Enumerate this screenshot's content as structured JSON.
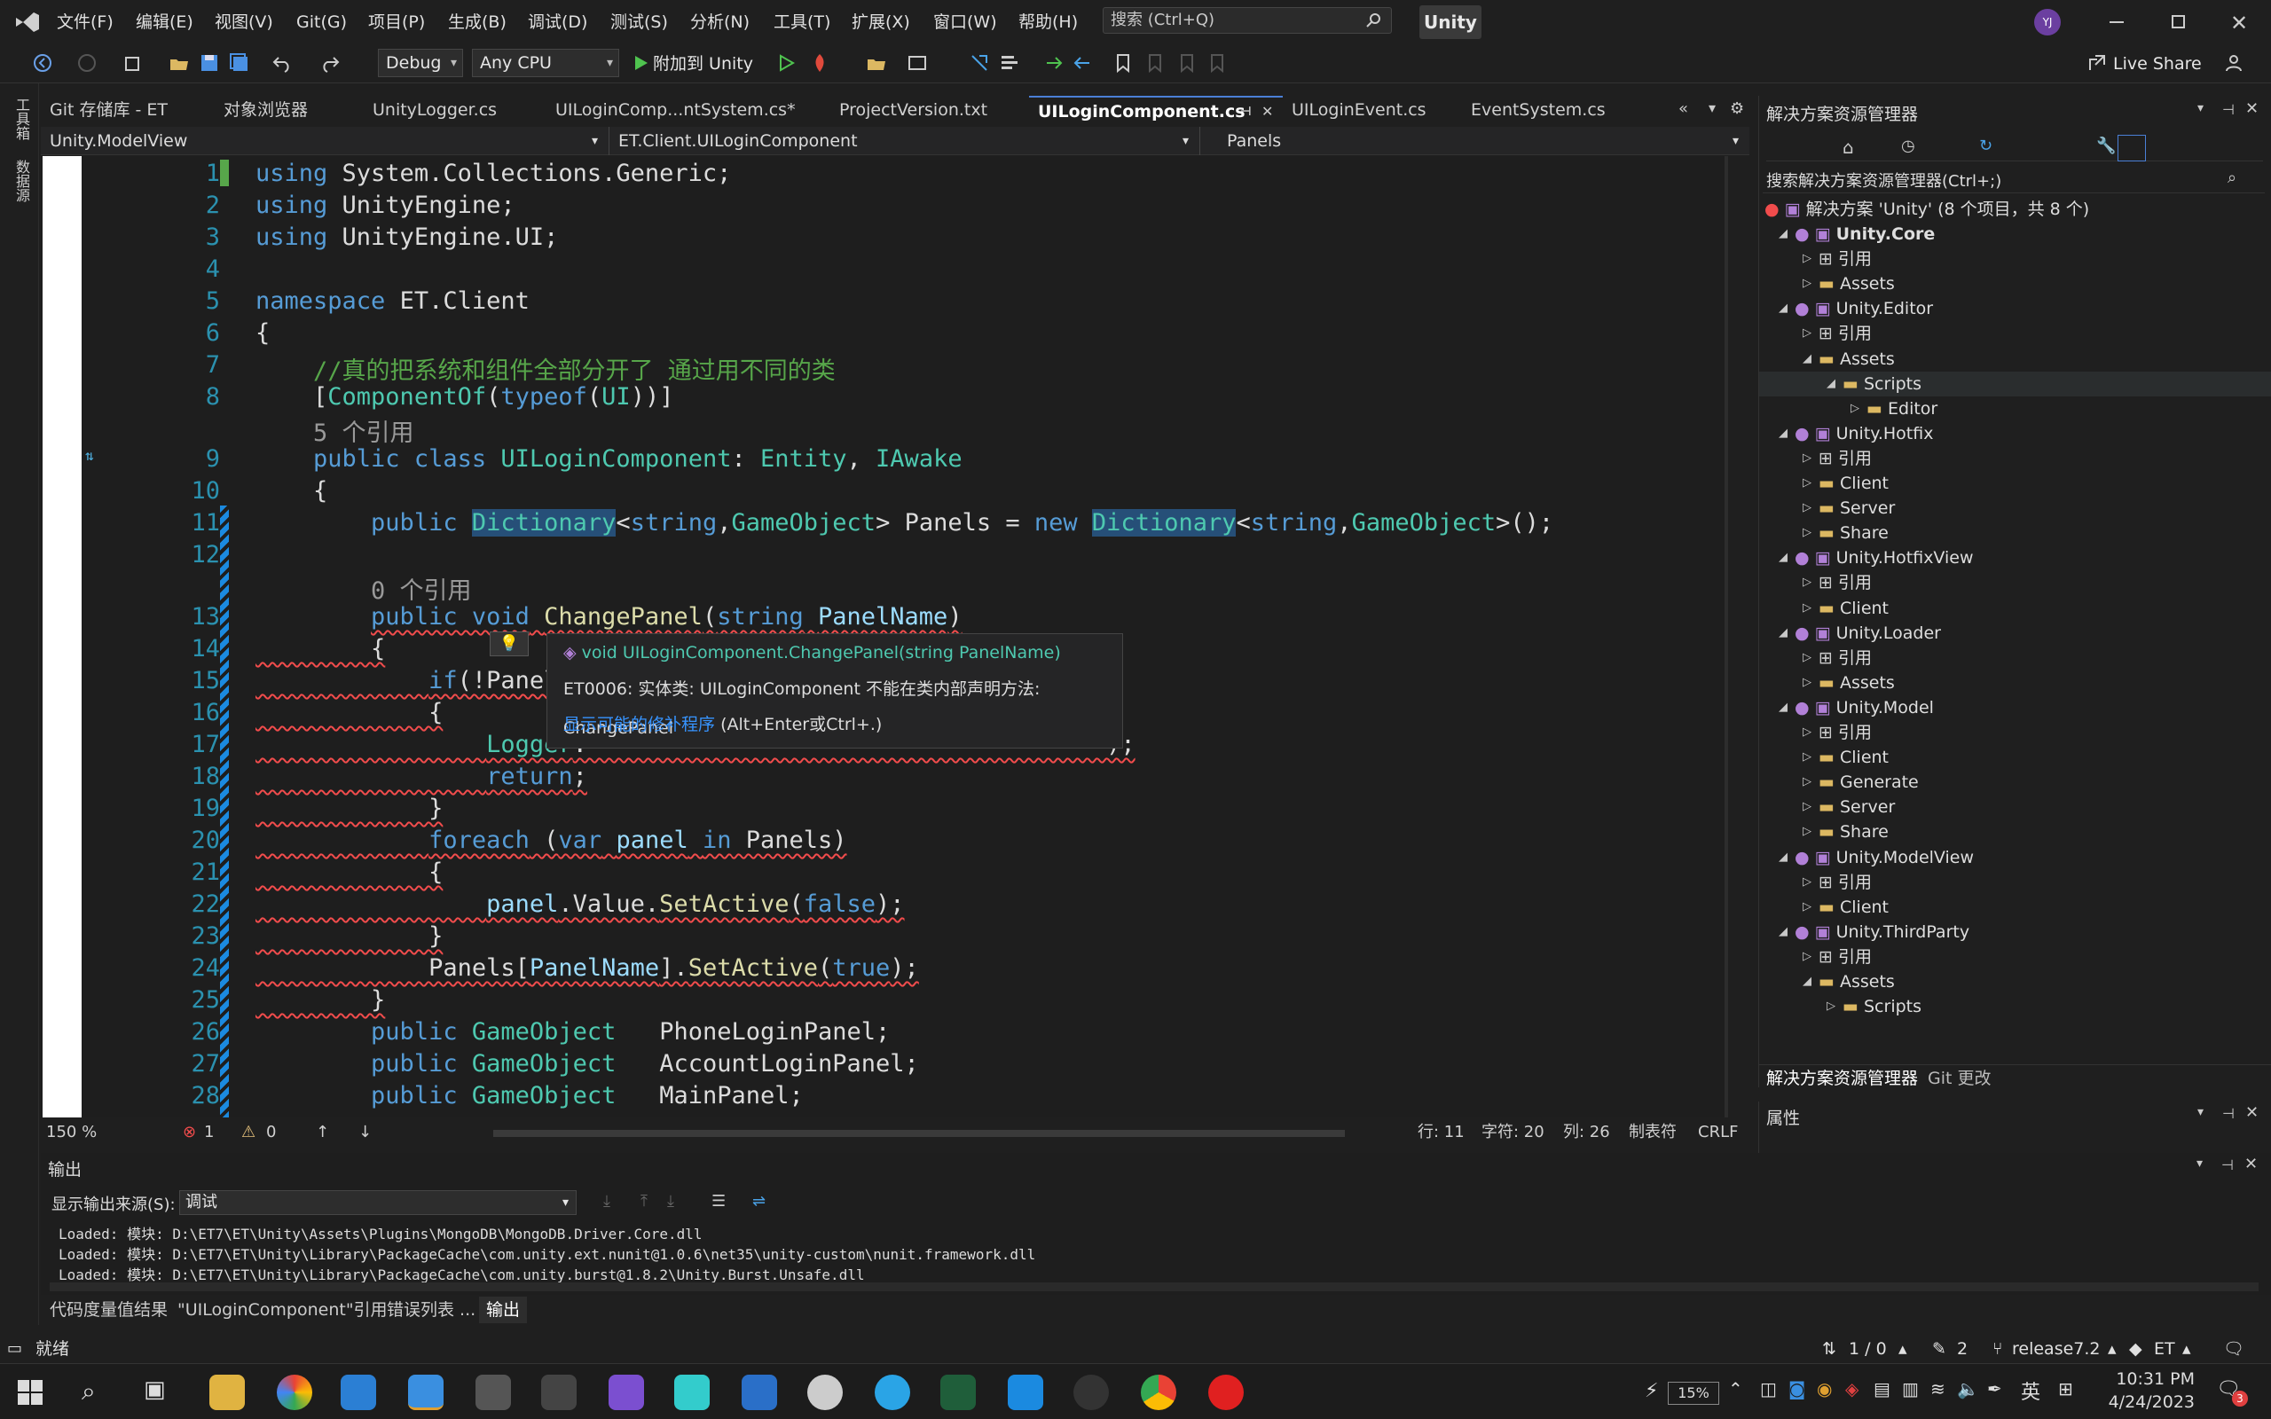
{
  "titlebar": {
    "menus": [
      "文件(F)",
      "编辑(E)",
      "视图(V)",
      "Git(G)",
      "项目(P)",
      "生成(B)",
      "调试(D)",
      "测试(S)",
      "分析(N)",
      "工具(T)",
      "扩展(X)",
      "窗口(W)",
      "帮助(H)"
    ],
    "search_placeholder": "搜索 (Ctrl+Q)",
    "solution_badge": "Unity",
    "avatar": "YJ"
  },
  "toolbar": {
    "config": "Debug",
    "platform": "Any CPU",
    "attach": "附加到 Unity",
    "live_share": "Live Share"
  },
  "leftstrip": {
    "items": [
      "工具箱",
      "数据源"
    ]
  },
  "tabs": [
    {
      "label": "Git 存储库 - ET"
    },
    {
      "label": "对象浏览器"
    },
    {
      "label": "UnityLogger.cs"
    },
    {
      "label": "UILoginComp...ntSystem.cs*"
    },
    {
      "label": "ProjectVersion.txt"
    },
    {
      "label": "UILoginComponent.cs",
      "active": true
    },
    {
      "label": "UILoginEvent.cs"
    },
    {
      "label": "EventSystem.cs"
    }
  ],
  "navbar": {
    "project": "Unity.ModelView",
    "type": "ET.Client.UILoginComponent",
    "member": "Panels"
  },
  "code": [
    {
      "n": "1",
      "t": "using System.Collections.Generic;"
    },
    {
      "n": "2",
      "t": "using UnityEngine;"
    },
    {
      "n": "3",
      "t": "using UnityEngine.UI;"
    },
    {
      "n": "4",
      "t": ""
    },
    {
      "n": "5",
      "t": "namespace ET.Client"
    },
    {
      "n": "6",
      "t": "{"
    },
    {
      "n": "7",
      "t": "    //真的把系统和组件全部分开了 通过用不同的类"
    },
    {
      "n": "8",
      "t": "    [ComponentOf(typeof(UI))]"
    },
    {
      "n": "",
      "t": "    5 个引用"
    },
    {
      "n": "9",
      "t": "    public class UILoginComponent: Entity, IAwake"
    },
    {
      "n": "10",
      "t": "    {"
    },
    {
      "n": "11",
      "t": "        public Dictionary<string,GameObject> Panels = new Dictionary<string,GameObject>();"
    },
    {
      "n": "12",
      "t": ""
    },
    {
      "n": "",
      "t": "        0 个引用"
    },
    {
      "n": "13",
      "t": "        public void ChangePanel(string PanelName)"
    },
    {
      "n": "14",
      "t": "        {"
    },
    {
      "n": "15",
      "t": "            if(!Panels."
    },
    {
      "n": "16",
      "t": "            {"
    },
    {
      "n": "17",
      "t": "                Logger."
    },
    {
      "n": "18",
      "t": "                return;"
    },
    {
      "n": "19",
      "t": "            }"
    },
    {
      "n": "20",
      "t": "            foreach (var panel in Panels)"
    },
    {
      "n": "21",
      "t": "            {"
    },
    {
      "n": "22",
      "t": "                panel.Value.SetActive(false);"
    },
    {
      "n": "23",
      "t": "            }"
    },
    {
      "n": "24",
      "t": "            Panels[PanelName].SetActive(true);"
    },
    {
      "n": "25",
      "t": "        }"
    },
    {
      "n": "26",
      "t": "        public GameObject   PhoneLoginPanel;"
    },
    {
      "n": "27",
      "t": "        public GameObject   AccountLoginPanel;"
    },
    {
      "n": "28",
      "t": "        public GameObject   MainPanel;"
    }
  ],
  "tooltip": {
    "signature": "void UILoginComponent.ChangePanel(string PanelName)",
    "error": "ET0006: 实体类: UILoginComponent 不能在类内部声明方法: ChangePanel",
    "fix_link": "显示可能的修补程序",
    "fix_keys": "(Alt+Enter或Ctrl+.)"
  },
  "editor_status": {
    "zoom": "150 %",
    "errors": "1",
    "warnings": "0",
    "line": "行: 11",
    "char": "字符: 20",
    "col": "列: 26",
    "tabs": "制表符",
    "eol": "CRLF"
  },
  "solution_explorer": {
    "title": "解决方案资源管理器",
    "search": "搜索解决方案资源管理器(Ctrl+;)",
    "solution": "解决方案 'Unity' (8 个项目，共 8 个)",
    "items": [
      {
        "label": "Unity.Core",
        "level": 1,
        "bold": true,
        "open": true,
        "kind": "proj"
      },
      {
        "label": "引用",
        "level": 2,
        "kind": "ref"
      },
      {
        "label": "Assets",
        "level": 2,
        "kind": "folder"
      },
      {
        "label": "Unity.Editor",
        "level": 1,
        "open": true,
        "kind": "proj"
      },
      {
        "label": "引用",
        "level": 2,
        "kind": "ref"
      },
      {
        "label": "Assets",
        "level": 2,
        "open": true,
        "kind": "folder"
      },
      {
        "label": "Scripts",
        "level": 3,
        "open": true,
        "kind": "folder",
        "selected": true
      },
      {
        "label": "Editor",
        "level": 4,
        "kind": "folder"
      },
      {
        "label": "Unity.Hotfix",
        "level": 1,
        "open": true,
        "kind": "proj"
      },
      {
        "label": "引用",
        "level": 2,
        "kind": "ref"
      },
      {
        "label": "Client",
        "level": 2,
        "kind": "folder"
      },
      {
        "label": "Server",
        "level": 2,
        "kind": "folder"
      },
      {
        "label": "Share",
        "level": 2,
        "kind": "folder"
      },
      {
        "label": "Unity.HotfixView",
        "level": 1,
        "open": true,
        "kind": "proj"
      },
      {
        "label": "引用",
        "level": 2,
        "kind": "ref"
      },
      {
        "label": "Client",
        "level": 2,
        "kind": "folder"
      },
      {
        "label": "Unity.Loader",
        "level": 1,
        "open": true,
        "kind": "proj"
      },
      {
        "label": "引用",
        "level": 2,
        "kind": "ref"
      },
      {
        "label": "Assets",
        "level": 2,
        "kind": "folder"
      },
      {
        "label": "Unity.Model",
        "level": 1,
        "open": true,
        "kind": "proj"
      },
      {
        "label": "引用",
        "level": 2,
        "kind": "ref"
      },
      {
        "label": "Client",
        "level": 2,
        "kind": "folder"
      },
      {
        "label": "Generate",
        "level": 2,
        "kind": "folder"
      },
      {
        "label": "Server",
        "level": 2,
        "kind": "folder"
      },
      {
        "label": "Share",
        "level": 2,
        "kind": "folder"
      },
      {
        "label": "Unity.ModelView",
        "level": 1,
        "open": true,
        "kind": "proj"
      },
      {
        "label": "引用",
        "level": 2,
        "kind": "ref"
      },
      {
        "label": "Client",
        "level": 2,
        "kind": "folder"
      },
      {
        "label": "Unity.ThirdParty",
        "level": 1,
        "open": true,
        "kind": "proj"
      },
      {
        "label": "引用",
        "level": 2,
        "kind": "ref"
      },
      {
        "label": "Assets",
        "level": 2,
        "open": true,
        "kind": "folder"
      },
      {
        "label": "Scripts",
        "level": 3,
        "kind": "folder"
      }
    ],
    "bottom_tabs": [
      "解决方案资源管理器",
      "Git 更改"
    ]
  },
  "properties": {
    "title": "属性"
  },
  "output": {
    "title": "输出",
    "source_label": "显示输出来源(S):",
    "source_value": "调试",
    "lines": [
      "Loaded: 模块: D:\\ET7\\ET\\Unity\\Assets\\Plugins\\MongoDB\\MongoDB.Driver.Core.dll",
      "Loaded: 模块: D:\\ET7\\ET\\Unity\\Library\\PackageCache\\com.unity.ext.nunit@1.0.6\\net35\\unity-custom\\nunit.framework.dll",
      "Loaded: 模块: D:\\ET7\\ET\\Unity\\Library\\PackageCache\\com.unity.burst@1.8.2\\Unity.Burst.Unsafe.dll"
    ]
  },
  "bottom_tabs": [
    "代码度量值结果",
    "\"UILoginComponent\"引用",
    "错误列表 ...",
    "输出"
  ],
  "statusbar": {
    "ready": "就绪",
    "commits": "1 / 0",
    "changes": "2",
    "branch": "release7.2",
    "repo": "ET"
  },
  "taskbar": {
    "battery": "15%",
    "ime": "英",
    "time": "10:31 PM",
    "date": "4/24/2023",
    "notifications": "3"
  }
}
